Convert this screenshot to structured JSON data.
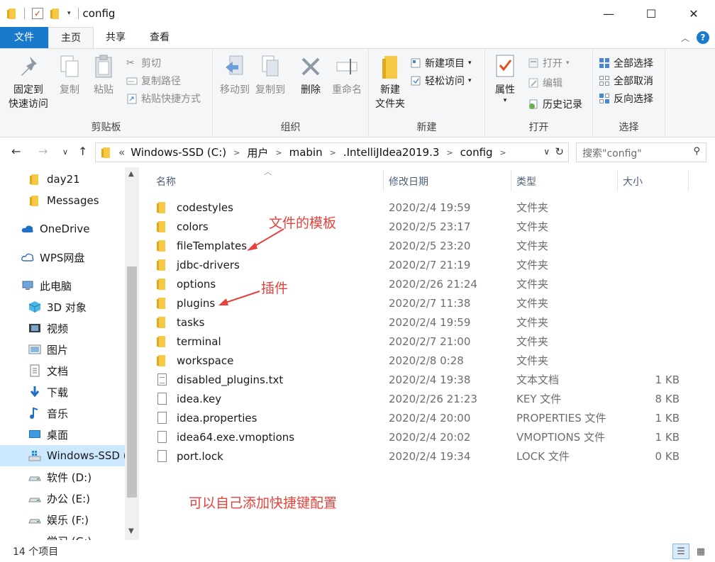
{
  "window": {
    "title": "config",
    "controls": {
      "minimize": "—",
      "maximize": "☐",
      "close": "✕"
    }
  },
  "ribbon_tabs": [
    "文件",
    "主页",
    "共享",
    "查看"
  ],
  "ribbon": {
    "clipboard": {
      "label": "剪贴板",
      "pin": [
        "固定到",
        "快速访问"
      ],
      "copy": "复制",
      "paste": "粘贴",
      "cut": "剪切",
      "copy_path": "复制路径",
      "paste_shortcut": "粘贴快捷方式"
    },
    "organize": {
      "label": "组织",
      "move_to": "移动到",
      "copy_to": "复制到",
      "delete": "删除",
      "rename": "重命名"
    },
    "new": {
      "label": "新建",
      "new_folder": [
        "新建",
        "文件夹"
      ],
      "new_item": "新建项目",
      "easy_access": "轻松访问"
    },
    "open": {
      "label": "打开",
      "properties": "属性",
      "open": "打开",
      "edit": "编辑",
      "history": "历史记录"
    },
    "select": {
      "label": "选择",
      "select_all": "全部选择",
      "select_none": "全部取消",
      "invert": "反向选择"
    }
  },
  "address": {
    "overflow": "«",
    "crumbs": [
      "Windows-SSD (C:)",
      "用户",
      "mabin",
      ".IntelliJIdea2019.3",
      "config"
    ]
  },
  "search": {
    "placeholder": "搜索\"config\""
  },
  "sidebar": {
    "items": [
      {
        "label": "day21",
        "icon": "folder-icon"
      },
      {
        "label": "Messages",
        "icon": "folder-icon"
      },
      {
        "label": "OneDrive",
        "icon": "cloud-icon"
      },
      {
        "label": "WPS网盘",
        "icon": "cloud-outline-icon"
      },
      {
        "label": "此电脑",
        "icon": "computer-icon"
      },
      {
        "label": "3D 对象",
        "icon": "cube-icon"
      },
      {
        "label": "视频",
        "icon": "video-icon"
      },
      {
        "label": "图片",
        "icon": "picture-icon"
      },
      {
        "label": "文档",
        "icon": "document-icon"
      },
      {
        "label": "下载",
        "icon": "download-icon"
      },
      {
        "label": "音乐",
        "icon": "music-icon"
      },
      {
        "label": "桌面",
        "icon": "desktop-icon"
      },
      {
        "label": "Windows-SSD (C:)",
        "icon": "windows-drive-icon"
      },
      {
        "label": "软件 (D:)",
        "icon": "drive-icon"
      },
      {
        "label": "办公 (E:)",
        "icon": "drive-icon"
      },
      {
        "label": "娱乐 (F:)",
        "icon": "drive-icon"
      },
      {
        "label": "学习 (G:)",
        "icon": "drive-icon"
      }
    ],
    "selected_index": 12
  },
  "columns": {
    "name": "名称",
    "date": "修改日期",
    "type": "类型",
    "size": "大小"
  },
  "files": [
    {
      "name": "codestyles",
      "date": "2020/2/4 19:59",
      "type": "文件夹",
      "size": "",
      "kind": "folder"
    },
    {
      "name": "colors",
      "date": "2020/2/5 23:17",
      "type": "文件夹",
      "size": "",
      "kind": "folder"
    },
    {
      "name": "fileTemplates",
      "date": "2020/2/5 23:20",
      "type": "文件夹",
      "size": "",
      "kind": "folder"
    },
    {
      "name": "jdbc-drivers",
      "date": "2020/2/7 21:19",
      "type": "文件夹",
      "size": "",
      "kind": "folder"
    },
    {
      "name": "options",
      "date": "2020/2/26 21:24",
      "type": "文件夹",
      "size": "",
      "kind": "folder"
    },
    {
      "name": "plugins",
      "date": "2020/2/7 11:38",
      "type": "文件夹",
      "size": "",
      "kind": "folder"
    },
    {
      "name": "tasks",
      "date": "2020/2/4 19:59",
      "type": "文件夹",
      "size": "",
      "kind": "folder"
    },
    {
      "name": "terminal",
      "date": "2020/2/7 21:00",
      "type": "文件夹",
      "size": "",
      "kind": "folder"
    },
    {
      "name": "workspace",
      "date": "2020/2/8 0:28",
      "type": "文件夹",
      "size": "",
      "kind": "folder"
    },
    {
      "name": "disabled_plugins.txt",
      "date": "2020/2/4 19:38",
      "type": "文本文档",
      "size": "1 KB",
      "kind": "text"
    },
    {
      "name": "idea.key",
      "date": "2020/2/26 21:23",
      "type": "KEY 文件",
      "size": "8 KB",
      "kind": "file"
    },
    {
      "name": "idea.properties",
      "date": "2020/2/4 20:00",
      "type": "PROPERTIES 文件",
      "size": "1 KB",
      "kind": "file"
    },
    {
      "name": "idea64.exe.vmoptions",
      "date": "2020/2/4 20:02",
      "type": "VMOPTIONS 文件",
      "size": "1 KB",
      "kind": "file"
    },
    {
      "name": "port.lock",
      "date": "2020/2/4 19:34",
      "type": "LOCK 文件",
      "size": "0 KB",
      "kind": "file"
    }
  ],
  "annotations": {
    "file_templates": "文件的模板",
    "plugins": "插件",
    "shortcut_config": "可以自己添加快捷键配置"
  },
  "status": {
    "item_count": "14 个项目"
  },
  "colors": {
    "accent": "#1979ca",
    "annotation": "#e8413b",
    "selection": "#cce8ff",
    "folder": "#f6c945"
  }
}
